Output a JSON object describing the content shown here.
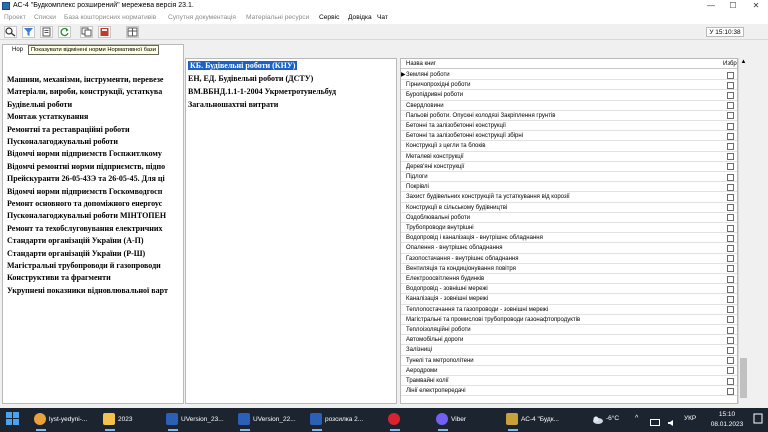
{
  "window": {
    "title": "АС-4 \"Будкомплекс розширений\"  мережева версія 23.1.",
    "minimize": "—",
    "maximize": "☐",
    "close": "✕"
  },
  "menu": [
    {
      "label": "Проект",
      "enabled": false
    },
    {
      "label": "Списки",
      "enabled": false
    },
    {
      "label": "База кошторисних нормативів",
      "enabled": false
    },
    {
      "label": "Супутня документація",
      "enabled": false
    },
    {
      "label": "Матеріальні ресурси",
      "enabled": false
    },
    {
      "label": "Сервіс",
      "enabled": true
    },
    {
      "label": "Довідка",
      "enabled": true
    },
    {
      "label": "Чат",
      "enabled": true
    }
  ],
  "toolbar": {
    "buttons": [
      "search-icon",
      "filter-icon",
      "document-icon",
      "refresh-icon",
      "copy-icon",
      "book-icon",
      "grid-icon"
    ],
    "clock": "У 15:10:38"
  },
  "tooltip": "Показувати відмінені норми Нормативної бази",
  "left_header": "Нор",
  "left_list": [
    "Машини, механізми, інструменти, перевезе",
    "Матеріали, вироби, конструкції, устаткува",
    "Будівельні роботи",
    "Монтаж устаткування",
    "Ремонтні та реставраційні роботи",
    "Пусконалагоджувальні роботи",
    "Відомчі норми підприємств Госпжитлкому",
    "Відомчі ремонтні норми підприємств, підпо",
    "Прейскуранти 26-05-43Э та 26-05-45. Для ці",
    "Відомчі норми підприємств Госкомводгосп",
    "Ремонт основного та допоміжного енергоус",
    "Пусконалагоджувальні роботи МІНТОПЕН",
    "Ремонт та техобслуговування електричних",
    "Стандарти організацій України (А-П)",
    "Стандарти організацій України (Р-Ш)",
    "Магістральні трубопроводи й газопроводи",
    "Конструктиви та фрагменти",
    "Укрупнені показники відновлювальної варт"
  ],
  "middle_list": [
    {
      "label": "КБ. Будівельні роботи (КНУ)",
      "selected": true
    },
    {
      "label": "ЕН, ЕД. Будівельні роботи (ДСТУ)",
      "selected": false
    },
    {
      "label": "ВМ.ВБНД.1.1-1-2004 Укрметротунельбуд",
      "selected": false
    },
    {
      "label": "Загальношахтні витрати",
      "selected": false
    }
  ],
  "right_table": {
    "col_name": "Назва книг",
    "col_fav": "Избр",
    "pointer": "▶",
    "rows": [
      "Земляні роботи",
      "Гірничопрохідні роботи",
      "Буропідривні роботи",
      "Свердловини",
      "Пальові роботи. Опускні колодязі Закріплення грунтів",
      "Бетонні та залізобетонні конструкції",
      "Бетонні та залізобетонні конструкції збірні",
      "Конструкції з цегли та блоків",
      "Металеві конструкції",
      "Дерев'яні конструкції",
      "Підлоги",
      "Покрівлі",
      "Захист будівельних конструкцій та устаткування від корозії",
      "Конструкції в сільському будівництві",
      "Оздоблювальні роботи",
      "Трубопроводи внутрішні",
      "Водопровід і каналізація - внутрішнє обладнання",
      "Опалення - внутрішнє обладнання",
      "Газопостачання - внутрішнє обладнання",
      "Вентиляція та кондиціонування повітря",
      "Електроосвітлення будинків",
      "Водопровід - зовнішні мережі",
      "Каналізація - зовнішні мережі",
      "Теплопостачання та газопроводи - зовнішні мережі",
      "Магістральні та промислові трубопроводи газонафтопродуктів",
      "Теплоізоляційні роботи",
      "Автомобільні дороги",
      "Залізниці",
      "Тунелі та метрополітени",
      "Аеродроми",
      "Трамвайні колії",
      "Лінії електропередачі"
    ]
  },
  "taskbar": {
    "items": [
      {
        "label": "lyst-yedyni-...",
        "icon": "chrome-icon",
        "color": "#e8a33d"
      },
      {
        "label": "2023",
        "icon": "folder-icon",
        "color": "#f2c14e"
      },
      {
        "label": "UVersion_23...",
        "icon": "word-icon",
        "color": "#2b5fb8"
      },
      {
        "label": "UVersion_22...",
        "icon": "word-icon",
        "color": "#2b5fb8"
      },
      {
        "label": "розсилка 2...",
        "icon": "word-icon",
        "color": "#2b5fb8"
      },
      {
        "label": "",
        "icon": "opera-icon",
        "color": "#d9232e"
      },
      {
        "label": "Viber",
        "icon": "viber-icon",
        "color": "#7360f2"
      },
      {
        "label": "АС-4 \"Будк...",
        "icon": "ac4-icon",
        "color": "#c9a13b"
      }
    ],
    "weather": "-6°C",
    "language": "УКР",
    "time": "15:10",
    "date": "08.01.2023"
  }
}
